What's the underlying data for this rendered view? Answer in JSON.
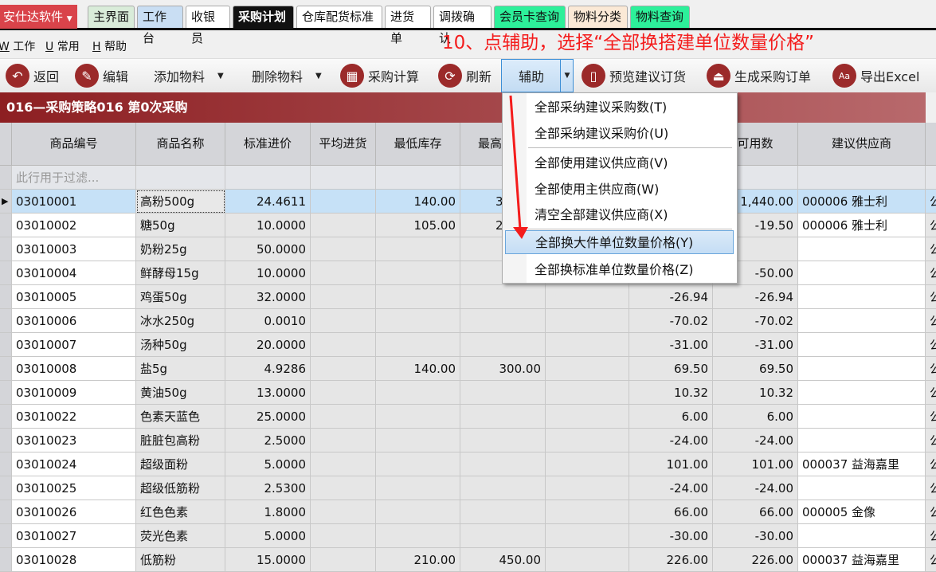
{
  "brand": {
    "label": "安仕达软件"
  },
  "tabs": [
    {
      "label": "主界面",
      "bg": "#d9ecd9"
    },
    {
      "label": "工作台",
      "bg": "#c9def3"
    },
    {
      "label": "收银员",
      "bg": "#ffffff"
    },
    {
      "label": "采购计划",
      "bg": "#111111",
      "active": true
    },
    {
      "label": "仓库配货标准",
      "bg": "#ffffff"
    },
    {
      "label": "进货单",
      "bg": "#ffffff"
    },
    {
      "label": "调拨确认",
      "bg": "#ffffff"
    },
    {
      "label": "会员卡查询",
      "bg": "#2df09a"
    },
    {
      "label": "物料分类",
      "bg": "#fbe9d6"
    },
    {
      "label": "物料查询",
      "bg": "#2df09a"
    }
  ],
  "menubar": [
    {
      "key": "W",
      "label": "工作"
    },
    {
      "key": "U",
      "label": "常用"
    },
    {
      "key": "H",
      "label": "帮助"
    }
  ],
  "annotation": "10、点辅助，选择“全部换搭建单位数量价格”",
  "toolbar": {
    "back": "返回",
    "edit": "编辑",
    "add": "添加物料",
    "delete": "删除物料",
    "calc": "采购计算",
    "refresh": "刷新",
    "assist": "辅助",
    "preview": "预览建议订货",
    "generate": "生成采购订单",
    "export": "导出Excel"
  },
  "title": "016—采购策略016  第0次采购",
  "table": {
    "headers": [
      "商品编号",
      "商品名称",
      "标准进价",
      "平均进货",
      "最低库存",
      "最高",
      "",
      "",
      "可用数",
      "建议供应商",
      ""
    ],
    "filter_placeholder": "此行用于过滤...",
    "rows": [
      [
        "03010001",
        "高粉500g",
        "24.4611",
        "",
        "140.00",
        "3",
        "",
        "",
        "1,440.00",
        "000006 雅士利",
        "公"
      ],
      [
        "03010002",
        "糖50g",
        "10.0000",
        "",
        "105.00",
        "2",
        "",
        "",
        "-19.50",
        "000006 雅士利",
        "公"
      ],
      [
        "03010003",
        "奶粉25g",
        "50.0000",
        "",
        "",
        "",
        "",
        "",
        "",
        "",
        "公"
      ],
      [
        "03010004",
        "鲜酵母15g",
        "10.0000",
        "",
        "",
        "",
        "",
        "",
        "-50.00",
        "",
        "公"
      ],
      [
        "03010005",
        "鸡蛋50g",
        "32.0000",
        "",
        "",
        "",
        "",
        "-26.94",
        "-26.94",
        "",
        "公"
      ],
      [
        "03010006",
        "冰水250g",
        "0.0010",
        "",
        "",
        "",
        "",
        "-70.02",
        "-70.02",
        "",
        "公"
      ],
      [
        "03010007",
        "汤种50g",
        "20.0000",
        "",
        "",
        "",
        "",
        "-31.00",
        "-31.00",
        "",
        "公"
      ],
      [
        "03010008",
        "盐5g",
        "4.9286",
        "",
        "140.00",
        "300.00",
        "",
        "69.50",
        "69.50",
        "",
        "公"
      ],
      [
        "03010009",
        "黄油50g",
        "13.0000",
        "",
        "",
        "",
        "",
        "10.32",
        "10.32",
        "",
        "公"
      ],
      [
        "03010022",
        "色素天蓝色",
        "25.0000",
        "",
        "",
        "",
        "",
        "6.00",
        "6.00",
        "",
        "公"
      ],
      [
        "03010023",
        "脏脏包高粉",
        "2.5000",
        "",
        "",
        "",
        "",
        "-24.00",
        "-24.00",
        "",
        "公"
      ],
      [
        "03010024",
        "超级面粉",
        "5.0000",
        "",
        "",
        "",
        "",
        "101.00",
        "101.00",
        "000037 益海嘉里",
        "公"
      ],
      [
        "03010025",
        "超级低筋粉",
        "2.5300",
        "",
        "",
        "",
        "",
        "-24.00",
        "-24.00",
        "",
        "公"
      ],
      [
        "03010026",
        "红色色素",
        "1.8000",
        "",
        "",
        "",
        "",
        "66.00",
        "66.00",
        "000005 金像",
        "公"
      ],
      [
        "03010027",
        "荧光色素",
        "5.0000",
        "",
        "",
        "",
        "",
        "-30.00",
        "-30.00",
        "",
        "公"
      ],
      [
        "03010028",
        "低筋粉",
        "15.0000",
        "",
        "210.00",
        "450.00",
        "",
        "226.00",
        "226.00",
        "000037 益海嘉里",
        "公"
      ]
    ]
  },
  "dropdown": {
    "items": [
      "全部采纳建议采购数(T)",
      "全部采纳建议采购价(U)",
      "全部使用建议供应商(V)",
      "全部使用主供应商(W)",
      "清空全部建议供应商(X)",
      "全部换大件单位数量价格(Y)",
      "全部换标准单位数量价格(Z)"
    ],
    "highlighted": 5
  },
  "colors": {
    "accent": "#9b2a2a",
    "annotation": "#f41c1c",
    "selection": "#c6e1f7"
  }
}
